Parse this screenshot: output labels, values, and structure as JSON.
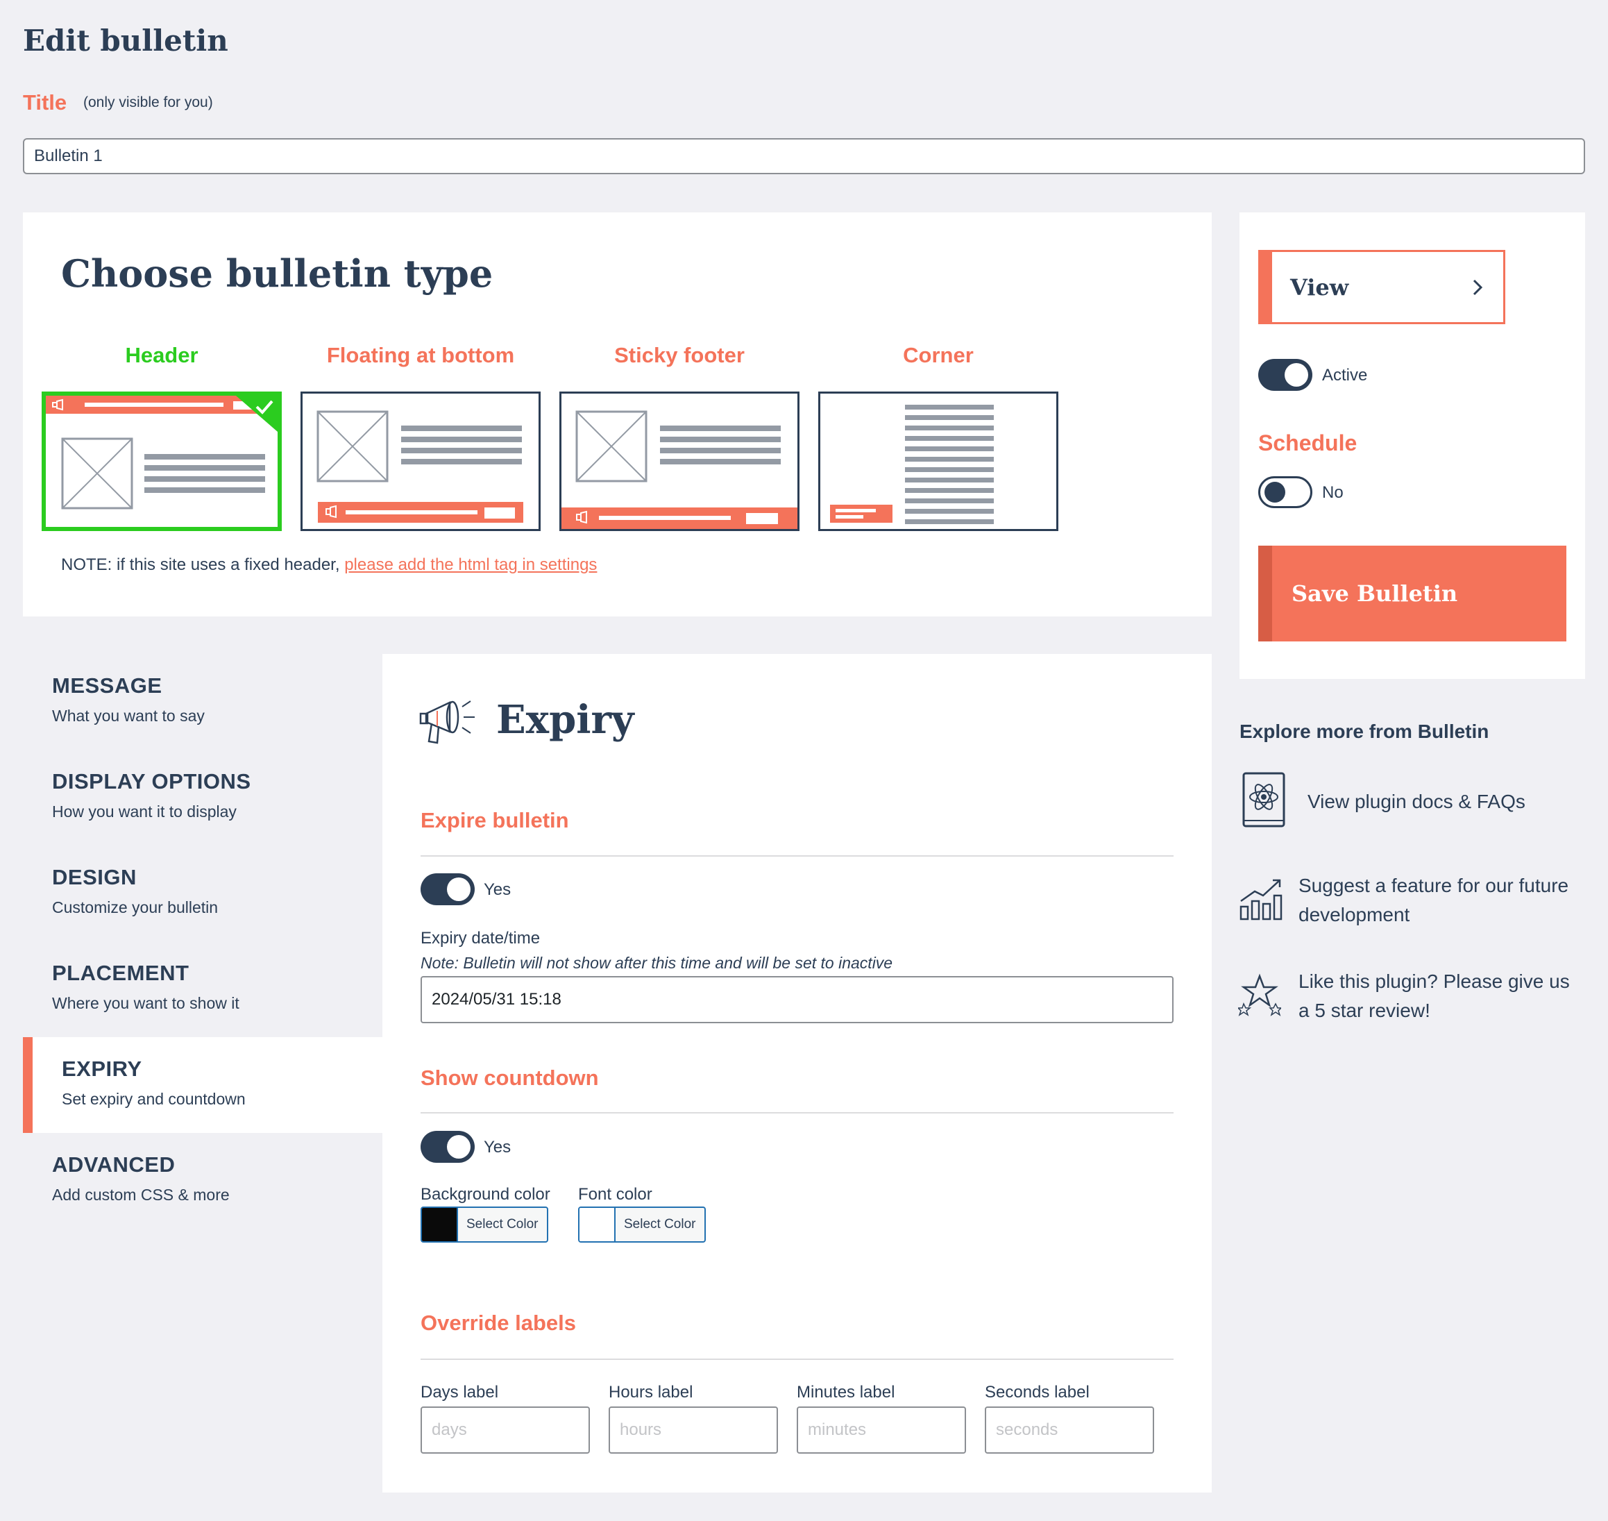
{
  "page": {
    "title": "Edit bulletin"
  },
  "title_field": {
    "label": "Title",
    "hint": "(only visible for you)",
    "value": "Bulletin 1"
  },
  "bulletin_type": {
    "heading": "Choose bulletin type",
    "options": [
      {
        "label": "Header",
        "selected": true
      },
      {
        "label": "Floating at bottom",
        "selected": false
      },
      {
        "label": "Sticky footer",
        "selected": false
      },
      {
        "label": "Corner",
        "selected": false
      }
    ],
    "note_prefix": "NOTE: if this site uses a fixed header, ",
    "note_link": "please add the html tag in settings"
  },
  "sidebar": {
    "view_label": "View",
    "active_label": "Active",
    "active_on": true,
    "schedule_label": "Schedule",
    "schedule_value": "No",
    "schedule_on": false,
    "save_label": "Save Bulletin"
  },
  "explore": {
    "title": "Explore more from Bulletin",
    "items": [
      {
        "icon": "book-atom-icon",
        "label": "View plugin docs & FAQs"
      },
      {
        "icon": "growth-chart-icon",
        "label_line1": "Suggest a feature for our future",
        "label_line2": "development"
      },
      {
        "icon": "star-trophy-icon",
        "label_line1": "Like this plugin? Please give us",
        "label_line2": "a 5 star review!"
      }
    ]
  },
  "nav": [
    {
      "title": "MESSAGE",
      "sub": "What you want to say",
      "active": false
    },
    {
      "title": "DISPLAY OPTIONS",
      "sub": "How you want it to display",
      "active": false
    },
    {
      "title": "DESIGN",
      "sub": "Customize your bulletin",
      "active": false
    },
    {
      "title": "PLACEMENT",
      "sub": "Where you want to show it",
      "active": false
    },
    {
      "title": "EXPIRY",
      "sub": "Set expiry and countdown",
      "active": true
    },
    {
      "title": "ADVANCED",
      "sub": "Add custom CSS & more",
      "active": false
    }
  ],
  "expiry": {
    "heading": "Expiry",
    "heading_icon": "megaphone-icon",
    "expire_section": "Expire bulletin",
    "expire_toggle": "Yes",
    "expire_on": true,
    "date_label": "Expiry date/time",
    "date_note": "Note: Bulletin will not show after this time and will be set to inactive",
    "date_value": "2024/05/31 15:18",
    "countdown_section": "Show countdown",
    "countdown_toggle": "Yes",
    "countdown_on": true,
    "bg_color_label": "Background color",
    "bg_color_value": "#0a0a0a",
    "font_color_label": "Font color",
    "font_color_value": "#ffffff",
    "select_color": "Select Color",
    "override_section": "Override labels",
    "labels": [
      {
        "label": "Days label",
        "placeholder": "days"
      },
      {
        "label": "Hours label",
        "placeholder": "hours"
      },
      {
        "label": "Minutes label",
        "placeholder": "minutes"
      },
      {
        "label": "Seconds label",
        "placeholder": "seconds"
      }
    ]
  },
  "colors": {
    "accent": "#f4735a",
    "navy": "#2c3e55",
    "selected": "#2bcc1f",
    "placeholder_gray": "#939aa4"
  }
}
